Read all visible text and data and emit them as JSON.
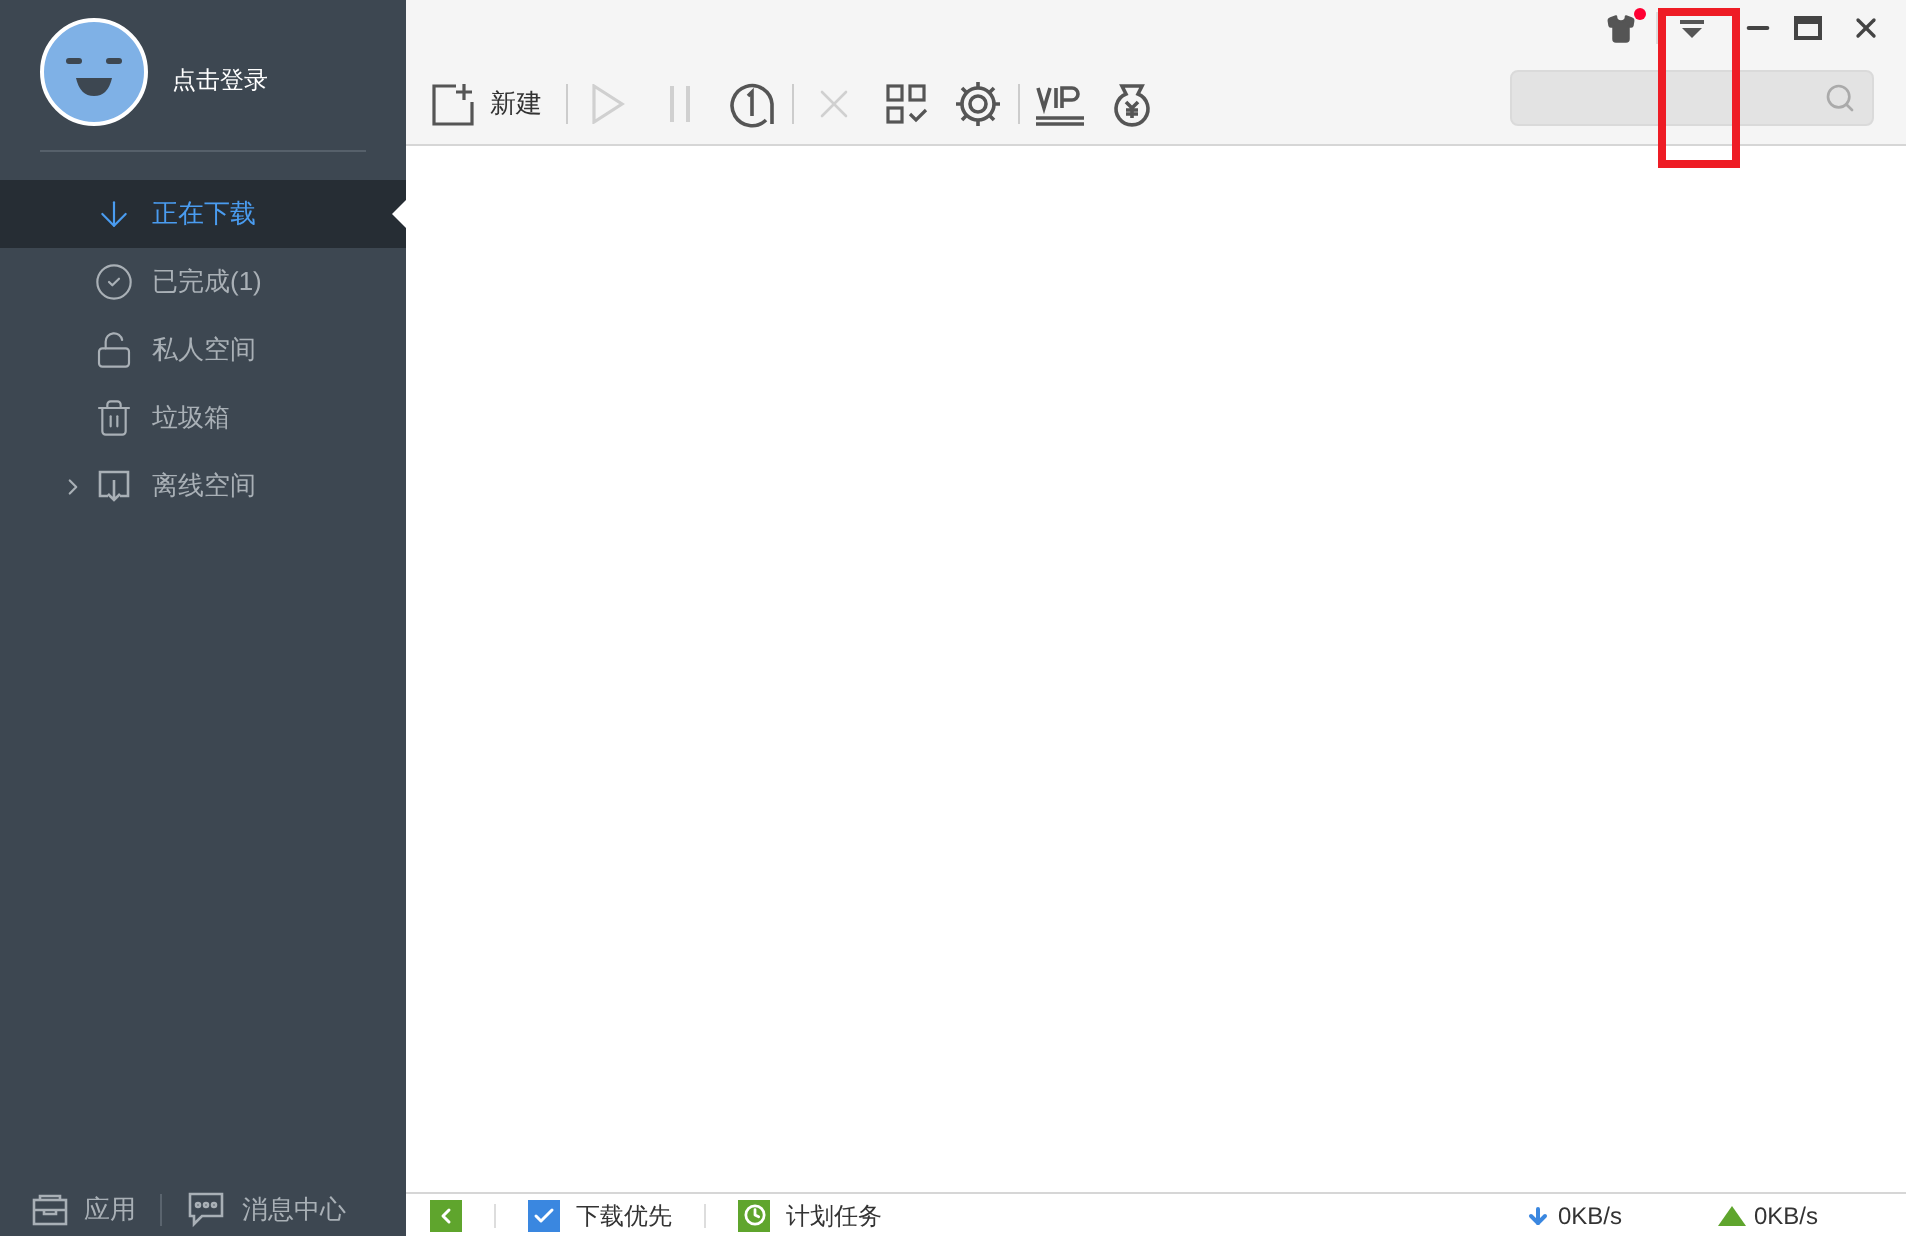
{
  "user": {
    "login_label": "点击登录"
  },
  "sidebar": {
    "items": [
      {
        "label": "正在下载",
        "selected": true
      },
      {
        "label": "已完成(1)",
        "selected": false
      },
      {
        "label": "私人空间",
        "selected": false
      },
      {
        "label": "垃圾箱",
        "selected": false
      },
      {
        "label": "离线空间",
        "selected": false,
        "expanded": false
      }
    ]
  },
  "sidebar_footer": [
    {
      "label": "应用"
    },
    {
      "label": "消息中心"
    }
  ],
  "toolbar": {
    "new_label": "新建"
  },
  "title_bar": {
    "notification": true
  },
  "annotation": {
    "highlight": true
  },
  "status_bar": {
    "items": [
      {
        "label": "下载优先",
        "kind": "check"
      },
      {
        "label": "计划任务",
        "kind": "plan"
      }
    ],
    "down_speed": "0KB/s",
    "up_speed": "0KB/s"
  }
}
